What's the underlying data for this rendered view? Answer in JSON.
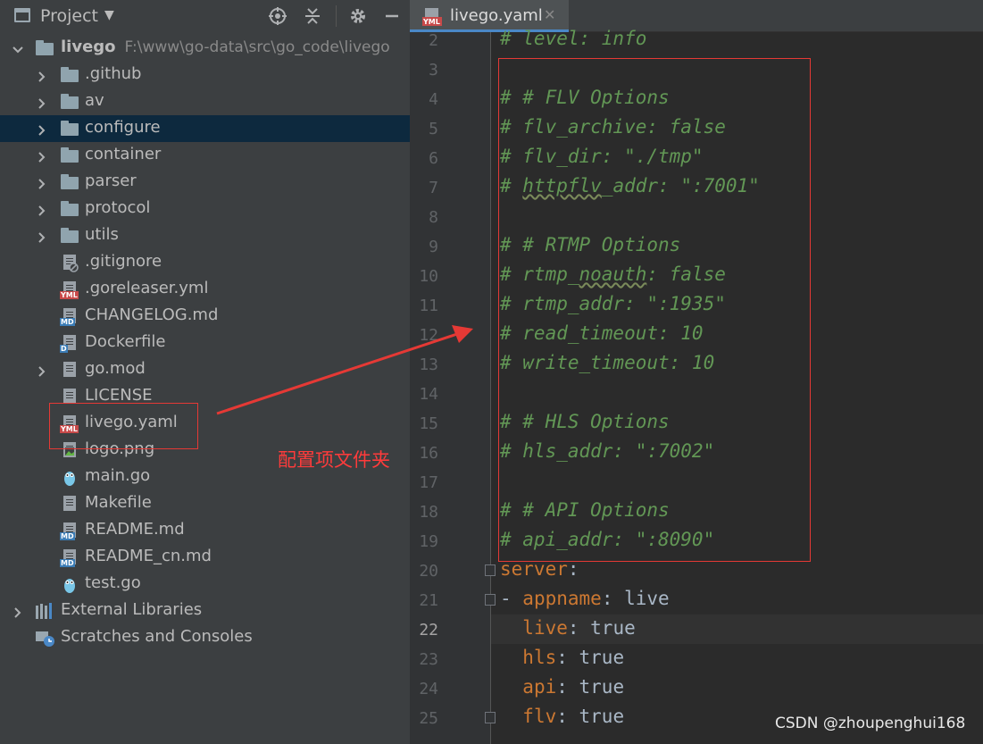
{
  "project_pane": {
    "title": "Project",
    "root": {
      "name": "livego",
      "path": "F:\\www\\go-data\\src\\go_code\\livego"
    },
    "items": [
      {
        "label": ".github",
        "type": "folder",
        "expandable": true
      },
      {
        "label": "av",
        "type": "folder",
        "expandable": true
      },
      {
        "label": "configure",
        "type": "folder",
        "expandable": true,
        "selected": true
      },
      {
        "label": "container",
        "type": "folder",
        "expandable": true
      },
      {
        "label": "parser",
        "type": "folder",
        "expandable": true
      },
      {
        "label": "protocol",
        "type": "folder",
        "expandable": true
      },
      {
        "label": "utils",
        "type": "folder",
        "expandable": true
      },
      {
        "label": ".gitignore",
        "type": "gitignore-file"
      },
      {
        "label": ".goreleaser.yml",
        "type": "yml-file"
      },
      {
        "label": "CHANGELOG.md",
        "type": "md-file"
      },
      {
        "label": "Dockerfile",
        "type": "docker-file"
      },
      {
        "label": "go.mod",
        "type": "text-file",
        "expandable": true
      },
      {
        "label": "LICENSE",
        "type": "text-file"
      },
      {
        "label": "livego.yaml",
        "type": "yml-file"
      },
      {
        "label": "logo.png",
        "type": "image-file"
      },
      {
        "label": "main.go",
        "type": "go-file"
      },
      {
        "label": "Makefile",
        "type": "text-file"
      },
      {
        "label": "README.md",
        "type": "md-file"
      },
      {
        "label": "README_cn.md",
        "type": "md-file"
      },
      {
        "label": "test.go",
        "type": "go-file"
      }
    ],
    "external_libraries": "External Libraries",
    "scratches": "Scratches and Consoles"
  },
  "editor": {
    "tab_label": "livego.yaml",
    "current_line": 22,
    "lines": [
      {
        "n": "2",
        "segs": [
          {
            "c": "cmt",
            "t": "# level: info"
          }
        ]
      },
      {
        "n": "3",
        "segs": []
      },
      {
        "n": "4",
        "segs": [
          {
            "c": "cmt",
            "t": "# # FLV Options"
          }
        ]
      },
      {
        "n": "5",
        "segs": [
          {
            "c": "cmt",
            "t": "# flv_archive: false"
          }
        ]
      },
      {
        "n": "6",
        "segs": [
          {
            "c": "cmt",
            "t": "# flv_dir: \"./tmp\""
          }
        ]
      },
      {
        "n": "7",
        "segs": [
          {
            "c": "cmt",
            "t": "# "
          },
          {
            "c": "cmt squig",
            "t": "httpflv"
          },
          {
            "c": "cmt",
            "t": "_addr: \":7001\""
          }
        ]
      },
      {
        "n": "8",
        "segs": []
      },
      {
        "n": "9",
        "segs": [
          {
            "c": "cmt",
            "t": "# # RTMP Options"
          }
        ]
      },
      {
        "n": "10",
        "segs": [
          {
            "c": "cmt",
            "t": "# rtmp_"
          },
          {
            "c": "cmt squig",
            "t": "noauth"
          },
          {
            "c": "cmt",
            "t": ": false"
          }
        ]
      },
      {
        "n": "11",
        "segs": [
          {
            "c": "cmt",
            "t": "# rtmp_addr: \":1935\""
          }
        ]
      },
      {
        "n": "12",
        "segs": [
          {
            "c": "cmt",
            "t": "# read_timeout: 10"
          }
        ]
      },
      {
        "n": "13",
        "segs": [
          {
            "c": "cmt",
            "t": "# write_timeout: 10"
          }
        ]
      },
      {
        "n": "14",
        "segs": []
      },
      {
        "n": "15",
        "segs": [
          {
            "c": "cmt",
            "t": "# # HLS Options"
          }
        ]
      },
      {
        "n": "16",
        "segs": [
          {
            "c": "cmt",
            "t": "# hls_addr: \":7002\""
          }
        ]
      },
      {
        "n": "17",
        "segs": []
      },
      {
        "n": "18",
        "segs": [
          {
            "c": "cmt",
            "t": "# # API Options"
          }
        ]
      },
      {
        "n": "19",
        "segs": [
          {
            "c": "cmt",
            "t": "# api_addr: \":8090\""
          }
        ]
      },
      {
        "n": "20",
        "segs": [
          {
            "c": "key",
            "t": "server"
          },
          {
            "c": "plain",
            "t": ":"
          }
        ]
      },
      {
        "n": "21",
        "segs": [
          {
            "c": "plain",
            "t": "- "
          },
          {
            "c": "key",
            "t": "appname"
          },
          {
            "c": "plain",
            "t": ": live"
          }
        ]
      },
      {
        "n": "22",
        "segs": [
          {
            "c": "plain",
            "t": "  "
          },
          {
            "c": "key",
            "t": "live"
          },
          {
            "c": "plain",
            "t": ": true"
          }
        ]
      },
      {
        "n": "23",
        "segs": [
          {
            "c": "plain",
            "t": "  "
          },
          {
            "c": "key",
            "t": "hls"
          },
          {
            "c": "plain",
            "t": ": true"
          }
        ]
      },
      {
        "n": "24",
        "segs": [
          {
            "c": "plain",
            "t": "  "
          },
          {
            "c": "key",
            "t": "api"
          },
          {
            "c": "plain",
            "t": ": true"
          }
        ]
      },
      {
        "n": "25",
        "segs": [
          {
            "c": "plain",
            "t": "  "
          },
          {
            "c": "key",
            "t": "flv"
          },
          {
            "c": "plain",
            "t": ": true"
          }
        ]
      }
    ]
  },
  "annotation": {
    "note": "配置项文件夹",
    "color": "#e53935"
  },
  "watermark": "CSDN @zhoupenghui168"
}
